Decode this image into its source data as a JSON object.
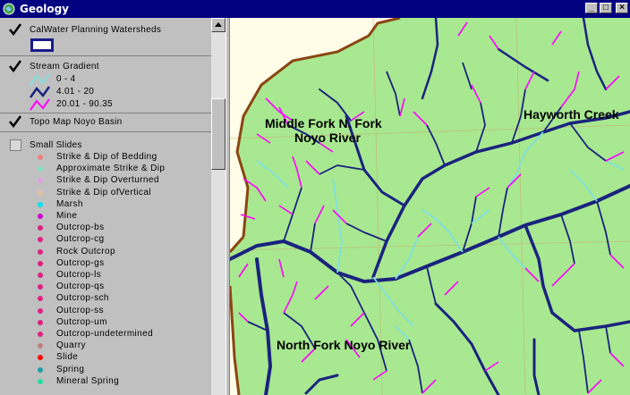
{
  "window": {
    "title": "Geology"
  },
  "legend": {
    "layers": [
      {
        "name": "CalWater Planning Watersheds",
        "checked": true
      },
      {
        "name": "Stream Gradient",
        "checked": true
      },
      {
        "name": "Topo Map Noyo Basin",
        "checked": true
      },
      {
        "name": "Small Slides",
        "checked": false
      }
    ],
    "gradient_classes": [
      {
        "label": "0 - 4",
        "color": "#80e0e0"
      },
      {
        "label": "4.01 - 20",
        "color": "#1a237e"
      },
      {
        "label": "20.01 - 90.35",
        "color": "#ff00ff"
      }
    ],
    "slide_types": [
      {
        "label": "Strike & Dip of Bedding",
        "color": "#f08080"
      },
      {
        "label": "Approximate Strike & Dip",
        "color": "#80e0c0"
      },
      {
        "label": "Strike & Dip Overturned",
        "color": "#e0a0e0"
      },
      {
        "label": "Strike & Dip ofVertical",
        "color": "#e0c0a0"
      },
      {
        "label": "Marsh",
        "color": "#00e0f0"
      },
      {
        "label": "Mine",
        "color": "#d000d0"
      },
      {
        "label": "Outcrop-bs",
        "color": "#e02080"
      },
      {
        "label": "Outcrop-cg",
        "color": "#e02080"
      },
      {
        "label": "Rock Outcrop",
        "color": "#e02080"
      },
      {
        "label": "Outcrop-gs",
        "color": "#e02080"
      },
      {
        "label": "Outcrop-ls",
        "color": "#e02080"
      },
      {
        "label": "Outcrop-qs",
        "color": "#e02080"
      },
      {
        "label": "Outcrop-sch",
        "color": "#e02080"
      },
      {
        "label": "Outcrop-ss",
        "color": "#e02080"
      },
      {
        "label": "Outcrop-um",
        "color": "#e02080"
      },
      {
        "label": "Outcrop-undetermined",
        "color": "#e02080"
      },
      {
        "label": "Quarry",
        "color": "#c08080"
      },
      {
        "label": "Slide",
        "color": "#ff0000"
      },
      {
        "label": "Spring",
        "color": "#20a0a0"
      },
      {
        "label": "Mineral Spring",
        "color": "#20e0a0"
      }
    ]
  },
  "map": {
    "labels": {
      "middle_fork_1": "Middle Fork N. Fork",
      "middle_fork_2": "Noyo River",
      "hayworth": "Hayworth Creek",
      "north_fork": "North Fork Noyo River"
    },
    "colors": {
      "land": "#a8e890",
      "outside": "#fffde8",
      "boundary": "#8b4513"
    }
  }
}
